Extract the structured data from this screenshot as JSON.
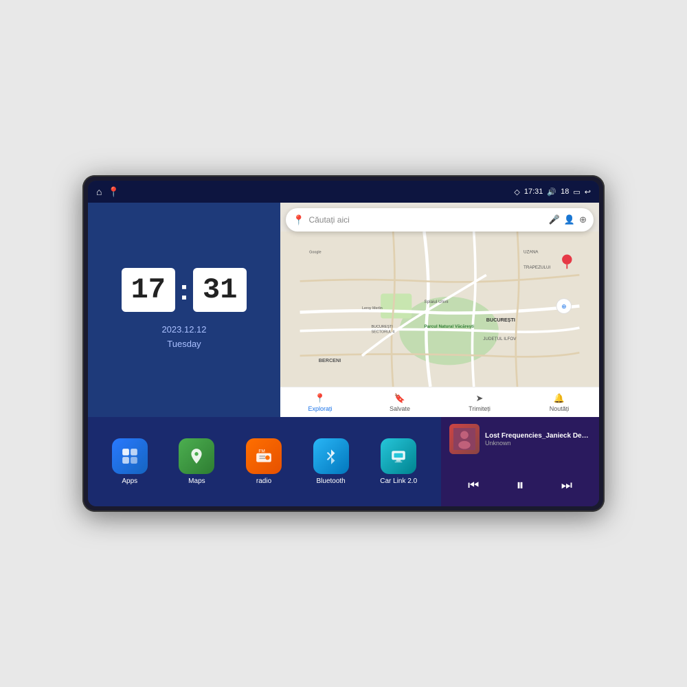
{
  "device": {
    "screen": "car-head-unit"
  },
  "statusBar": {
    "signal_icon": "◇",
    "time": "17:31",
    "volume_icon": "🔊",
    "battery": "18",
    "battery_icon": "▭",
    "back_icon": "↩"
  },
  "topLeft": {
    "home_icon": "⌂",
    "map_pin_icon": "📍"
  },
  "clock": {
    "hours": "17",
    "colon": ":",
    "minutes": "31",
    "date": "2023.12.12",
    "day": "Tuesday"
  },
  "map": {
    "search_placeholder": "Căutați aici",
    "pin_icon": "📍",
    "voice_icon": "🎤",
    "account_icon": "👤",
    "layers_icon": "⊕",
    "compass_icon": "✦",
    "nav_items": [
      {
        "label": "Explorați",
        "icon": "📍",
        "active": true
      },
      {
        "label": "Salvate",
        "icon": "🔖",
        "active": false
      },
      {
        "label": "Trimiteți",
        "icon": "➤",
        "active": false
      },
      {
        "label": "Noutăți",
        "icon": "🔔",
        "active": false
      }
    ],
    "labels": {
      "berceni": "BERCENI",
      "bucuresti": "BUCUREȘTI",
      "judet": "JUDEȚUL ILFOV",
      "trapezului": "TRAPEZULUI",
      "parcul": "Parcul Natural Văcărești",
      "leroy": "Leroy Merlin",
      "sector4": "BUCUREȘTI\nSECTORUL 4",
      "google": "Google",
      "uzana": "UZANA",
      "splai": "Splaiul Unirii"
    }
  },
  "apps": [
    {
      "id": "apps",
      "label": "Apps",
      "icon": "⊞",
      "color_class": "icon-apps"
    },
    {
      "id": "maps",
      "label": "Maps",
      "icon": "🗺",
      "color_class": "icon-maps"
    },
    {
      "id": "radio",
      "label": "radio",
      "icon": "📻",
      "color_class": "icon-radio"
    },
    {
      "id": "bluetooth",
      "label": "Bluetooth",
      "icon": "⦿",
      "color_class": "icon-bluetooth"
    },
    {
      "id": "carlink",
      "label": "Car Link 2.0",
      "icon": "🖥",
      "color_class": "icon-carlink"
    }
  ],
  "music": {
    "title": "Lost Frequencies_Janieck Devy-...",
    "artist": "Unknown",
    "prev_icon": "⏮",
    "play_icon": "⏸",
    "next_icon": "⏭",
    "thumb_icon": "🎵"
  }
}
